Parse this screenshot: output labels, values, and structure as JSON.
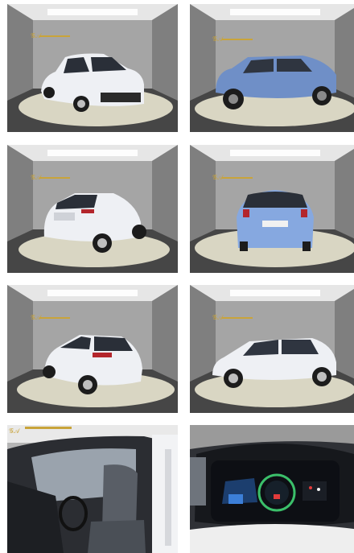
{
  "gallery": {
    "photos": [
      {
        "subject": "front-left",
        "color_body": "#eef0f4"
      },
      {
        "subject": "side-right",
        "color_body": "#6f8fc7"
      },
      {
        "subject": "rear-left",
        "color_body": "#eef0f4"
      },
      {
        "subject": "rear",
        "color_body": "#86a8e0"
      },
      {
        "subject": "rear-right",
        "color_body": "#eef0f4"
      },
      {
        "subject": "side-left",
        "color_body": "#eef0f4"
      },
      {
        "subject": "interior-seats"
      },
      {
        "subject": "instrument-cluster"
      }
    ]
  },
  "colors": {
    "studio_wall": "#9a9a9a",
    "studio_floor": "#4a4a4a",
    "turntable": "#d8d5c4",
    "logo_gold": "#c9a43a"
  }
}
